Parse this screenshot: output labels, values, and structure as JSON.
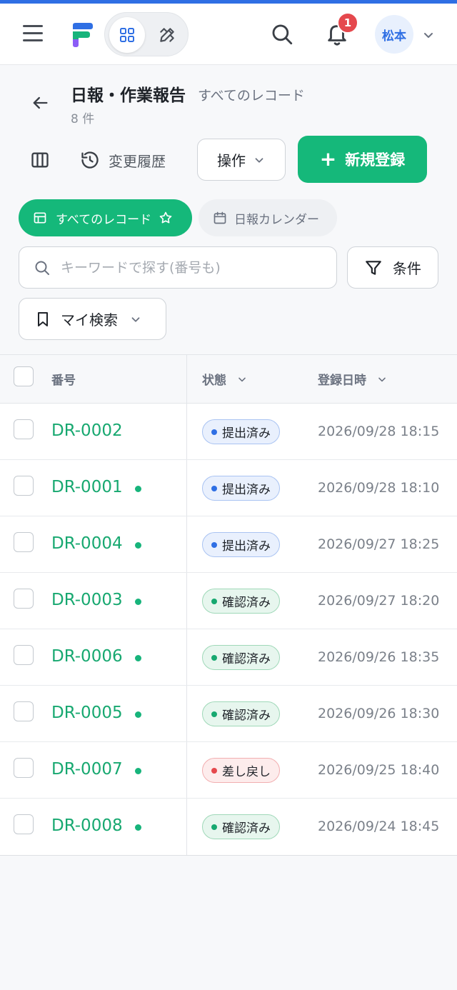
{
  "header": {
    "notification_count": "1",
    "user_name": "松本",
    "icons": [
      "menu-icon",
      "app-logo",
      "apps-grid-icon",
      "tools-icon",
      "search-icon",
      "bell-icon",
      "chevron-down-icon"
    ]
  },
  "page": {
    "title": "日報・作業報告",
    "view_name": "すべてのレコード",
    "count": "8 件"
  },
  "toolbar": {
    "history_label": "変更履歴",
    "ops_label": "操作",
    "new_label": "新規登録"
  },
  "views": {
    "all_records": "すべてのレコード",
    "calendar": "日報カレンダー"
  },
  "search": {
    "placeholder": "キーワードで探す(番号も)",
    "value": "",
    "condition_label": "条件",
    "my_search_label": "マイ検索"
  },
  "table": {
    "columns": [
      "番号",
      "状態",
      "登録日時"
    ],
    "rows": [
      {
        "number": "DR-0002",
        "status": "提出済み",
        "status_color": "blue",
        "date": "2026/09/28 18:15",
        "dot": false
      },
      {
        "number": "DR-0001",
        "status": "提出済み",
        "status_color": "blue",
        "date": "2026/09/28 18:10",
        "dot": true
      },
      {
        "number": "DR-0004",
        "status": "提出済み",
        "status_color": "blue",
        "date": "2026/09/27 18:25",
        "dot": true
      },
      {
        "number": "DR-0003",
        "status": "確認済み",
        "status_color": "green",
        "date": "2026/09/27 18:20",
        "dot": true
      },
      {
        "number": "DR-0006",
        "status": "確認済み",
        "status_color": "green",
        "date": "2026/09/26 18:35",
        "dot": true
      },
      {
        "number": "DR-0005",
        "status": "確認済み",
        "status_color": "green",
        "date": "2026/09/26 18:30",
        "dot": true
      },
      {
        "number": "DR-0007",
        "status": "差し戻し",
        "status_color": "red",
        "date": "2026/09/25 18:40",
        "dot": true
      },
      {
        "number": "DR-0008",
        "status": "確認済み",
        "status_color": "green",
        "date": "2026/09/24 18:45",
        "dot": true
      }
    ]
  },
  "colors": {
    "accent": "#15b87a",
    "link": "#17a870",
    "primary_blue": "#2f6fe4",
    "danger": "#e5484d"
  }
}
